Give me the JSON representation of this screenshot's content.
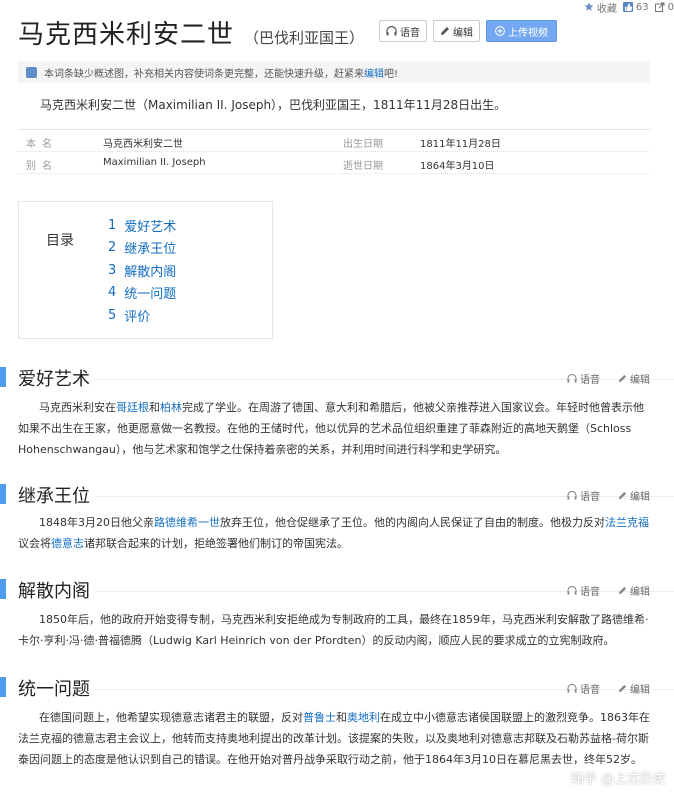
{
  "topbar": {
    "collect_label": "收藏",
    "like_count": "63",
    "share_count": "0"
  },
  "header": {
    "title": "马克西米利安二世",
    "subtitle": "（巴伐利亚国王）",
    "buttons": {
      "voice": "语音",
      "edit": "编辑",
      "upload": "上传视频"
    }
  },
  "notice": {
    "text_before": "本词条缺少概述图，补充相关内容使词条更完整，还能快速升级，赶紧来",
    "link": "编辑",
    "text_after": "吧!"
  },
  "summary": "马克西米利安二世（Maximilian II. Joseph），巴伐利亚国王，1811年11月28日出生。",
  "infobox": [
    {
      "k1": "本名",
      "v1": "马克西米利安二世",
      "k2": "出生日期",
      "v2": "1811年11月28日"
    },
    {
      "k1": "别名",
      "v1": "Maximilian II. Joseph",
      "k2": "逝世日期",
      "v2": "1864年3月10日"
    }
  ],
  "toc": {
    "title": "目录",
    "items": [
      {
        "num": "1",
        "label": "爱好艺术"
      },
      {
        "num": "2",
        "label": "继承王位"
      },
      {
        "num": "3",
        "label": "解散内阁"
      },
      {
        "num": "4",
        "label": "统一问题"
      },
      {
        "num": "5",
        "label": "评价"
      }
    ]
  },
  "tools": {
    "voice": "语音",
    "edit": "编辑"
  },
  "sections": [
    {
      "title": "爱好艺术",
      "para": [
        {
          "t": "马克西米利安在"
        },
        {
          "t": "哥廷根",
          "link": true
        },
        {
          "t": "和"
        },
        {
          "t": "柏林",
          "link": true
        },
        {
          "t": "完成了学业。在周游了德国、意大利和希腊后，他被父亲推荐进入国家议会。年轻时他曾表示他如果不出生在王家，他更愿意做一名教授。在他的王储时代，他以优异的艺术品位组织重建了菲森附近的高地天鹅堡（Schloss Hohenschwangau），他与艺术家和饱学之仕保持着亲密的关系，并利用时间进行科学和史学研究。"
        }
      ]
    },
    {
      "title": "继承王位",
      "para": [
        {
          "t": "1848年3月20日他父亲"
        },
        {
          "t": "路德维希一世",
          "link": true
        },
        {
          "t": "放弃王位，他仓促继承了王位。他的内阁向人民保证了自由的制度。他极力反对"
        },
        {
          "t": "法兰克福",
          "link": true
        },
        {
          "t": "议会将"
        },
        {
          "t": "德意志",
          "link": true
        },
        {
          "t": "诸邦联合起来的计划，拒绝签署他们制订的帝国宪法。"
        }
      ]
    },
    {
      "title": "解散内阁",
      "para": [
        {
          "t": "1850年后，他的政府开始变得专制，马克西米利安拒绝成为专制政府的工具，最终在1859年，马克西米利安解散了路德维希·卡尔·亨利·冯·德·普福德腾（Ludwig Karl Heinrich von der Pfordten）的反动内阁，顺应人民的要求成立的立宪制政府。"
        }
      ]
    },
    {
      "title": "统一问题",
      "para": [
        {
          "t": "在德国问题上，他希望实现德意志诸君主的联盟，反对"
        },
        {
          "t": "普鲁士",
          "link": true
        },
        {
          "t": "和"
        },
        {
          "t": "奥地利",
          "link": true
        },
        {
          "t": "在成立中小德意志诸侯国联盟上的激烈竞争。1863年在法兰克福的德意志君主会议上，他转而支持奥地利提出的改革计划。该提案的失败，以及奥地利对德意志邦联及石勒苏益格-荷尔斯泰因问题上的态度是他认识到自己的错误。在他开始对普丹战争采取行动之前，他于1864年3月10日在慕尼黑去世，终年52岁。"
        }
      ]
    }
  ],
  "watermark": "知乎 @上古历史"
}
